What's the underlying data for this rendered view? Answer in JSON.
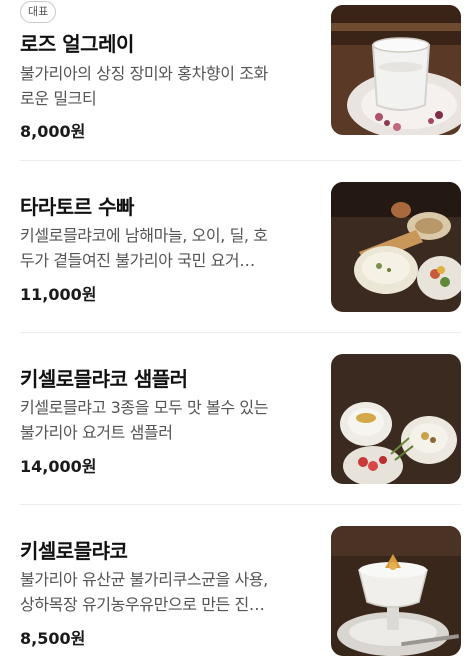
{
  "menu_items": [
    {
      "badge": "대표",
      "name": "로즈 얼그레이",
      "desc_line1": "불가리아의 상징 장미와 홍차향이 조화",
      "desc_line2": "로운 밀크티",
      "price": "8,000원",
      "photo_icon": "milk-tea-photo"
    },
    {
      "name": "타라토르 수빠",
      "desc_line1": "키셀로믈랴코에 남해마늘, 오이, 딜, 호",
      "desc_line2": "두가 곁들여진 불가리아 국민 요거…",
      "price": "11,000원",
      "photo_icon": "soup-photo"
    },
    {
      "name": "키셀로믈랴코 샘플러",
      "desc_line1": "키셀로믈랴고 3종을 모두 맛 볼수 있는",
      "desc_line2": "불가리아 요거트 샘플러",
      "price": "14,000원",
      "photo_icon": "yogurt-sampler-photo"
    },
    {
      "name": "키셀로믈랴코",
      "desc_line1": "불가리아 유산균 불가리쿠스균을 사용,",
      "desc_line2": "상하목장 유기농우유만으로 만든 진…",
      "price": "8,500원",
      "photo_icon": "yogurt-cup-photo"
    }
  ]
}
